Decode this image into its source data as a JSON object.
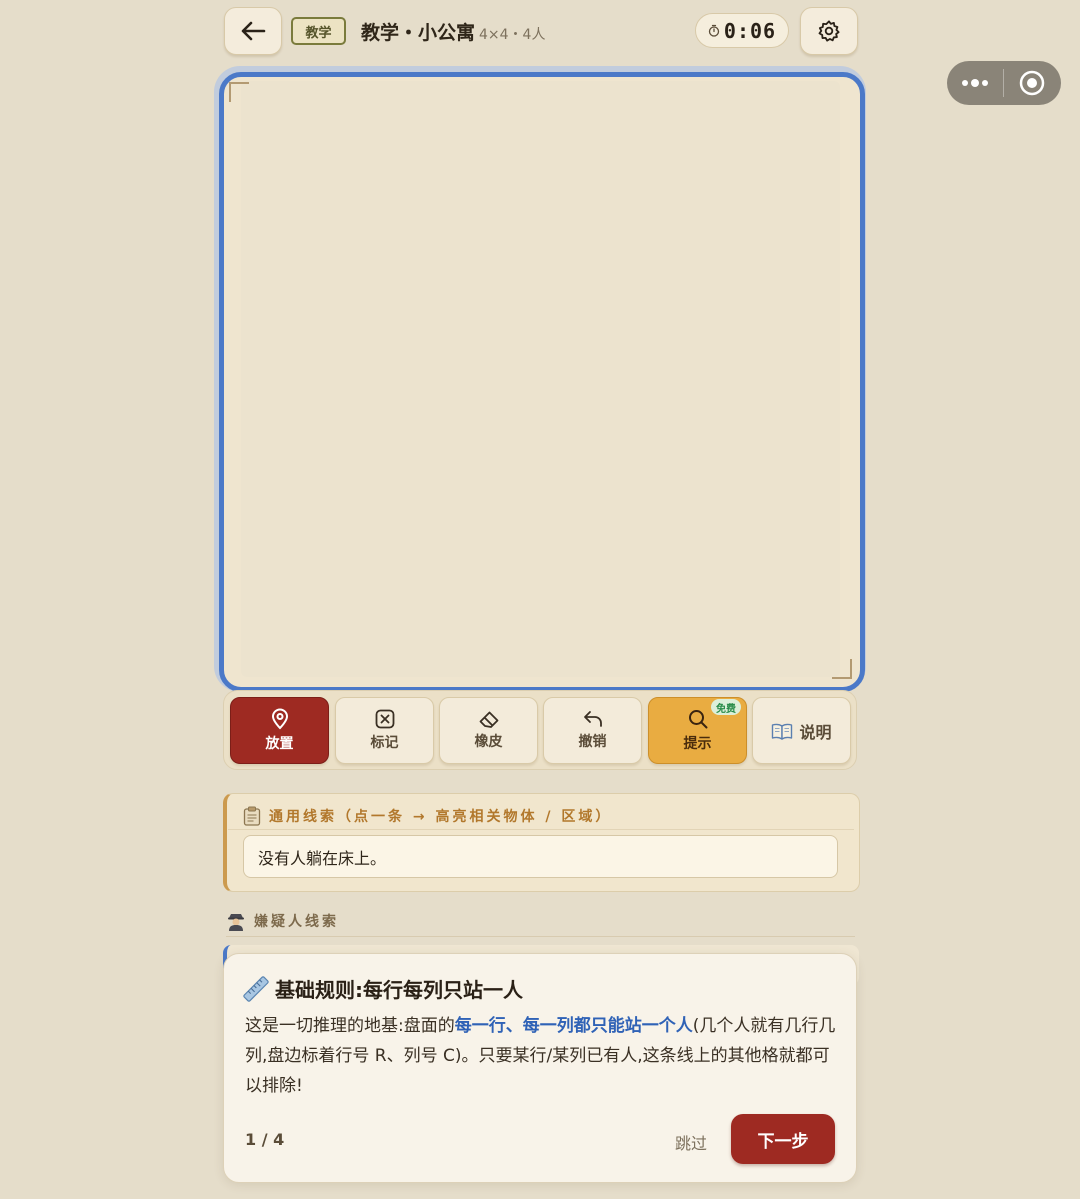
{
  "header": {
    "back_icon": "arrow-left-icon",
    "badge": "教学",
    "title": "教学・小公寓",
    "subtitle": "4×4・4人",
    "timer_icon": "stopwatch-icon",
    "timer": "0:06",
    "settings_icon": "gear-icon"
  },
  "capsule": {
    "more_icon": "more-dots-icon",
    "close_icon": "target-close-icon"
  },
  "toolbar": {
    "place": "放置",
    "mark": "标记",
    "erase": "橡皮",
    "undo": "撤销",
    "hint": "提示",
    "hint_badge": "免费",
    "explain": "说明",
    "active_tool": "place"
  },
  "clues": {
    "general_header": "通用线索（点一条 → 高亮相关物体 / 区域）",
    "items": [
      "没有人躺在床上。"
    ],
    "suspect_header": "嫌疑人线索"
  },
  "tutorial": {
    "title": "基础规则:每行每列只站一人",
    "body_pre": "这是一切推理的地基:盘面的",
    "body_highlight": "每一行、每一列都只能站一个人",
    "body_post": "(几个人就有几行几列,盘边标着行号 R、列号 C)。只要某行/某列已有人,这条线上的其他格就都可以排除!",
    "step": "1 / 4",
    "skip": "跳过",
    "next": "下一步"
  },
  "colors": {
    "accent_blue": "#4b79c8",
    "primary_red": "#9e2a22",
    "hint_gold": "#e9ac41",
    "background": "#e5ddca"
  }
}
